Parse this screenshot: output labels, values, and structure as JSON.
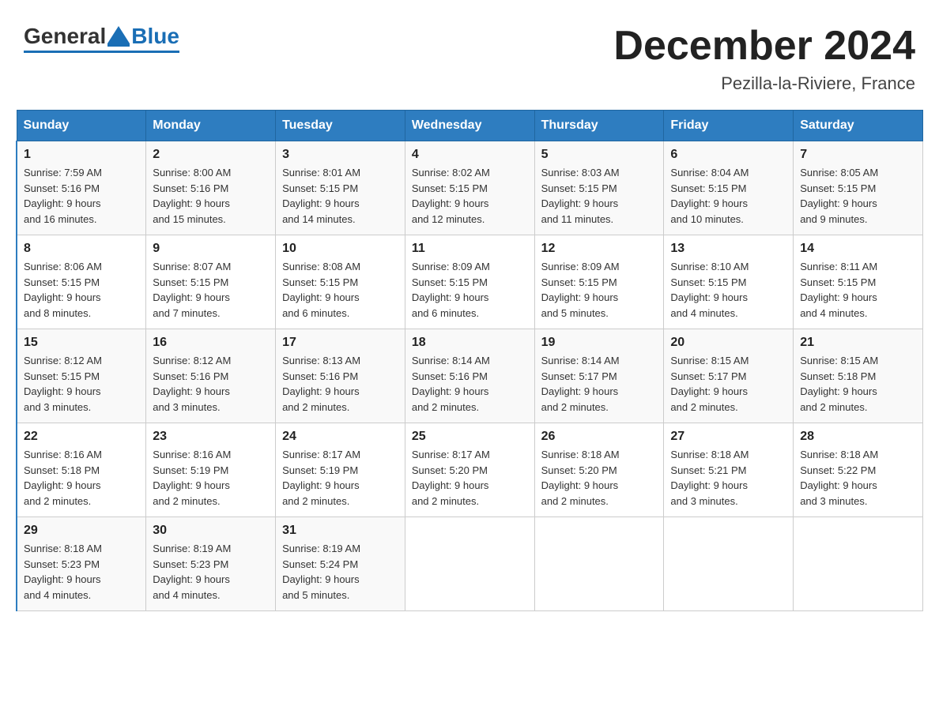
{
  "logo": {
    "general": "General",
    "blue": "Blue"
  },
  "title": "December 2024",
  "subtitle": "Pezilla-la-Riviere, France",
  "days_header": [
    "Sunday",
    "Monday",
    "Tuesday",
    "Wednesday",
    "Thursday",
    "Friday",
    "Saturday"
  ],
  "weeks": [
    [
      {
        "day": "1",
        "sunrise": "7:59 AM",
        "sunset": "5:16 PM",
        "daylight": "9 hours and 16 minutes."
      },
      {
        "day": "2",
        "sunrise": "8:00 AM",
        "sunset": "5:16 PM",
        "daylight": "9 hours and 15 minutes."
      },
      {
        "day": "3",
        "sunrise": "8:01 AM",
        "sunset": "5:15 PM",
        "daylight": "9 hours and 14 minutes."
      },
      {
        "day": "4",
        "sunrise": "8:02 AM",
        "sunset": "5:15 PM",
        "daylight": "9 hours and 12 minutes."
      },
      {
        "day": "5",
        "sunrise": "8:03 AM",
        "sunset": "5:15 PM",
        "daylight": "9 hours and 11 minutes."
      },
      {
        "day": "6",
        "sunrise": "8:04 AM",
        "sunset": "5:15 PM",
        "daylight": "9 hours and 10 minutes."
      },
      {
        "day": "7",
        "sunrise": "8:05 AM",
        "sunset": "5:15 PM",
        "daylight": "9 hours and 9 minutes."
      }
    ],
    [
      {
        "day": "8",
        "sunrise": "8:06 AM",
        "sunset": "5:15 PM",
        "daylight": "9 hours and 8 minutes."
      },
      {
        "day": "9",
        "sunrise": "8:07 AM",
        "sunset": "5:15 PM",
        "daylight": "9 hours and 7 minutes."
      },
      {
        "day": "10",
        "sunrise": "8:08 AM",
        "sunset": "5:15 PM",
        "daylight": "9 hours and 6 minutes."
      },
      {
        "day": "11",
        "sunrise": "8:09 AM",
        "sunset": "5:15 PM",
        "daylight": "9 hours and 6 minutes."
      },
      {
        "day": "12",
        "sunrise": "8:09 AM",
        "sunset": "5:15 PM",
        "daylight": "9 hours and 5 minutes."
      },
      {
        "day": "13",
        "sunrise": "8:10 AM",
        "sunset": "5:15 PM",
        "daylight": "9 hours and 4 minutes."
      },
      {
        "day": "14",
        "sunrise": "8:11 AM",
        "sunset": "5:15 PM",
        "daylight": "9 hours and 4 minutes."
      }
    ],
    [
      {
        "day": "15",
        "sunrise": "8:12 AM",
        "sunset": "5:15 PM",
        "daylight": "9 hours and 3 minutes."
      },
      {
        "day": "16",
        "sunrise": "8:12 AM",
        "sunset": "5:16 PM",
        "daylight": "9 hours and 3 minutes."
      },
      {
        "day": "17",
        "sunrise": "8:13 AM",
        "sunset": "5:16 PM",
        "daylight": "9 hours and 2 minutes."
      },
      {
        "day": "18",
        "sunrise": "8:14 AM",
        "sunset": "5:16 PM",
        "daylight": "9 hours and 2 minutes."
      },
      {
        "day": "19",
        "sunrise": "8:14 AM",
        "sunset": "5:17 PM",
        "daylight": "9 hours and 2 minutes."
      },
      {
        "day": "20",
        "sunrise": "8:15 AM",
        "sunset": "5:17 PM",
        "daylight": "9 hours and 2 minutes."
      },
      {
        "day": "21",
        "sunrise": "8:15 AM",
        "sunset": "5:18 PM",
        "daylight": "9 hours and 2 minutes."
      }
    ],
    [
      {
        "day": "22",
        "sunrise": "8:16 AM",
        "sunset": "5:18 PM",
        "daylight": "9 hours and 2 minutes."
      },
      {
        "day": "23",
        "sunrise": "8:16 AM",
        "sunset": "5:19 PM",
        "daylight": "9 hours and 2 minutes."
      },
      {
        "day": "24",
        "sunrise": "8:17 AM",
        "sunset": "5:19 PM",
        "daylight": "9 hours and 2 minutes."
      },
      {
        "day": "25",
        "sunrise": "8:17 AM",
        "sunset": "5:20 PM",
        "daylight": "9 hours and 2 minutes."
      },
      {
        "day": "26",
        "sunrise": "8:18 AM",
        "sunset": "5:20 PM",
        "daylight": "9 hours and 2 minutes."
      },
      {
        "day": "27",
        "sunrise": "8:18 AM",
        "sunset": "5:21 PM",
        "daylight": "9 hours and 3 minutes."
      },
      {
        "day": "28",
        "sunrise": "8:18 AM",
        "sunset": "5:22 PM",
        "daylight": "9 hours and 3 minutes."
      }
    ],
    [
      {
        "day": "29",
        "sunrise": "8:18 AM",
        "sunset": "5:23 PM",
        "daylight": "9 hours and 4 minutes."
      },
      {
        "day": "30",
        "sunrise": "8:19 AM",
        "sunset": "5:23 PM",
        "daylight": "9 hours and 4 minutes."
      },
      {
        "day": "31",
        "sunrise": "8:19 AM",
        "sunset": "5:24 PM",
        "daylight": "9 hours and 5 minutes."
      },
      null,
      null,
      null,
      null
    ]
  ],
  "labels": {
    "sunrise": "Sunrise: ",
    "sunset": "Sunset: ",
    "daylight": "Daylight: "
  }
}
